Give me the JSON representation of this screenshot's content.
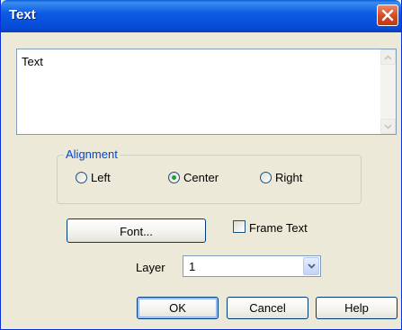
{
  "window": {
    "title": "Text"
  },
  "text_area": {
    "value": "Text"
  },
  "alignment": {
    "label": "Alignment",
    "options": [
      {
        "label": "Left",
        "selected": false
      },
      {
        "label": "Center",
        "selected": true
      },
      {
        "label": "Right",
        "selected": false
      }
    ]
  },
  "font_button": {
    "label": "Font..."
  },
  "frame_text": {
    "label": "Frame Text",
    "checked": false
  },
  "layer": {
    "label": "Layer",
    "value": "1"
  },
  "buttons": {
    "ok": "OK",
    "cancel": "Cancel",
    "help": "Help"
  },
  "colors": {
    "titlebar": "#0649d6",
    "accent_label": "#0046d5",
    "radio_dot": "#21a121"
  }
}
